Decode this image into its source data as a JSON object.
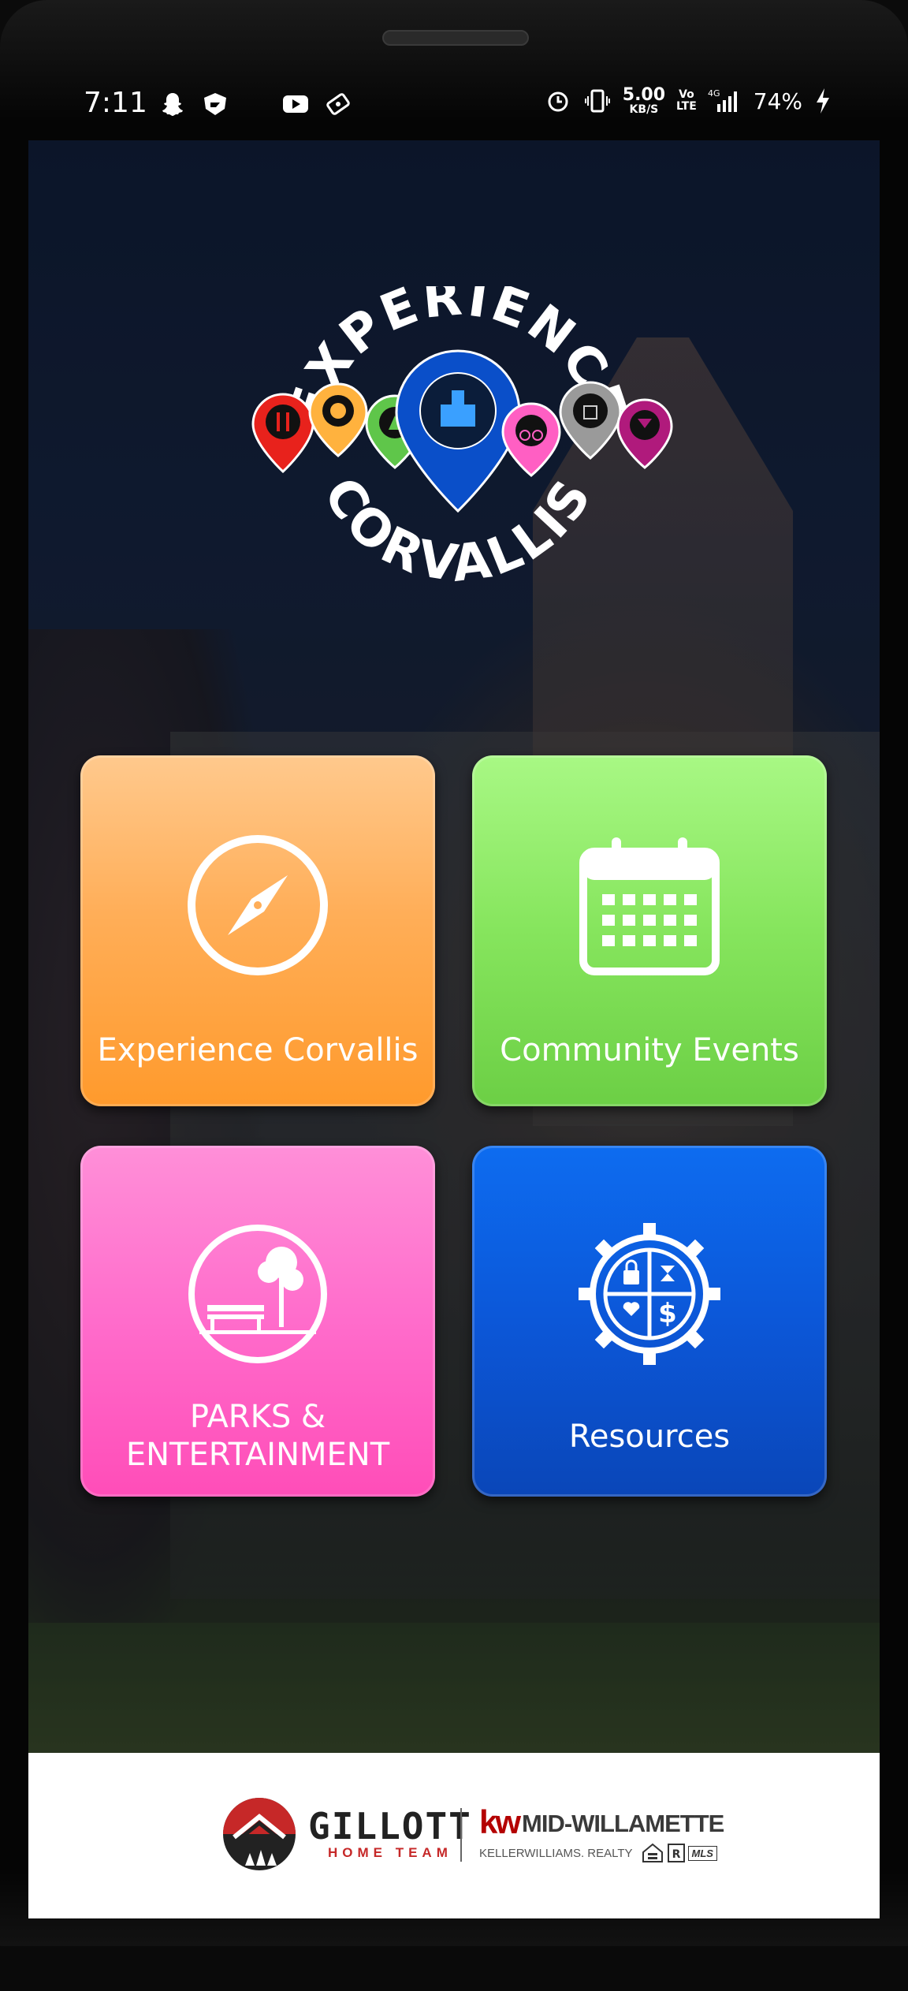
{
  "status_bar": {
    "time": "7:11",
    "net_speed_value": "5.00",
    "net_speed_unit": "KB/S",
    "volte_top": "Vo",
    "volte_bottom": "LTE",
    "network": "4G",
    "battery": "74%"
  },
  "logo": {
    "top_text": "EXPERIENCE",
    "bottom_text": "CORVALLIS",
    "pin_colors": [
      "#e8221c",
      "#ffb23e",
      "#5fc64a",
      "#0a4fc9",
      "#ff5fc3",
      "#9a9a9a",
      "#b01a7c"
    ]
  },
  "tiles": [
    {
      "label": "Experience Corvallis",
      "icon": "compass-icon",
      "color": "#ffae58"
    },
    {
      "label": "Community Events",
      "icon": "calendar-icon",
      "color": "#86e55d"
    },
    {
      "label_line1": "PARKS &",
      "label_line2": "ENTERTAINMENT",
      "icon": "park-bench-icon",
      "color": "#ff6ccb"
    },
    {
      "label": "Resources",
      "icon": "resources-gear-icon",
      "color": "#0c57d8"
    }
  ],
  "footer": {
    "gillott_name": "GILLOTT",
    "gillott_sub": "HOME TEAM",
    "kw_mark": "kw",
    "kw_office": "MID-WILLAMETTE",
    "kw_brand": "KELLERWILLIAMS. REALTY",
    "mls": "MLS"
  }
}
